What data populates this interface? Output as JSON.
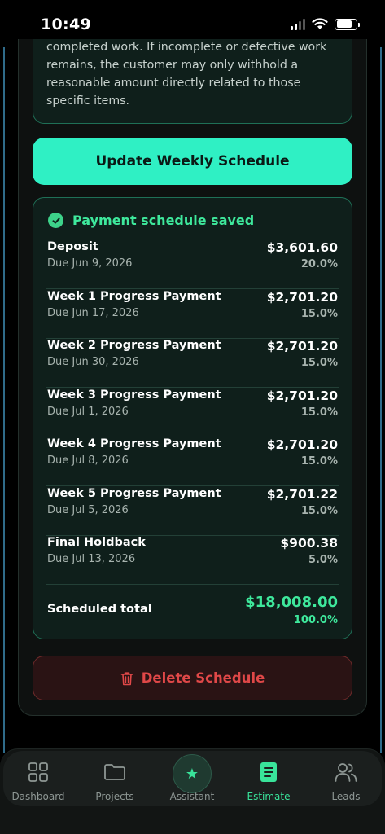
{
  "status_bar": {
    "time": "10:49"
  },
  "terms": {
    "text": "completed work. If incomplete or defective work remains, the customer may only withhold a reasonable amount directly related to those specific items."
  },
  "update_button": {
    "label": "Update Weekly Schedule"
  },
  "schedule": {
    "saved_message": "Payment schedule saved",
    "payments": [
      {
        "title": "Deposit",
        "due": "Due Jun 9, 2026",
        "amount": "$3,601.60",
        "percent": "20.0%"
      },
      {
        "title": "Week 1 Progress Payment",
        "due": "Due Jun 17, 2026",
        "amount": "$2,701.20",
        "percent": "15.0%"
      },
      {
        "title": "Week 2 Progress Payment",
        "due": "Due Jun 30, 2026",
        "amount": "$2,701.20",
        "percent": "15.0%"
      },
      {
        "title": "Week 3 Progress Payment",
        "due": "Due Jul 1, 2026",
        "amount": "$2,701.20",
        "percent": "15.0%"
      },
      {
        "title": "Week 4 Progress Payment",
        "due": "Due Jul 8, 2026",
        "amount": "$2,701.20",
        "percent": "15.0%"
      },
      {
        "title": "Week 5 Progress Payment",
        "due": "Due Jul 5, 2026",
        "amount": "$2,701.22",
        "percent": "15.0%"
      },
      {
        "title": "Final Holdback",
        "due": "Due Jul 13, 2026",
        "amount": "$900.38",
        "percent": "5.0%"
      }
    ],
    "total_label": "Scheduled total",
    "total_amount": "$18,008.00",
    "total_percent": "100.0%"
  },
  "delete_button": {
    "label": "Delete Schedule"
  },
  "tabs": [
    {
      "label": "Dashboard",
      "icon": "grid-icon"
    },
    {
      "label": "Projects",
      "icon": "folder-icon"
    },
    {
      "label": "Assistant",
      "icon": "star-icon"
    },
    {
      "label": "Estimate",
      "icon": "document-icon"
    },
    {
      "label": "Leads",
      "icon": "people-icon"
    }
  ],
  "colors": {
    "accent": "#2ff0c4",
    "success": "#3ee89c",
    "danger": "#e04848"
  }
}
